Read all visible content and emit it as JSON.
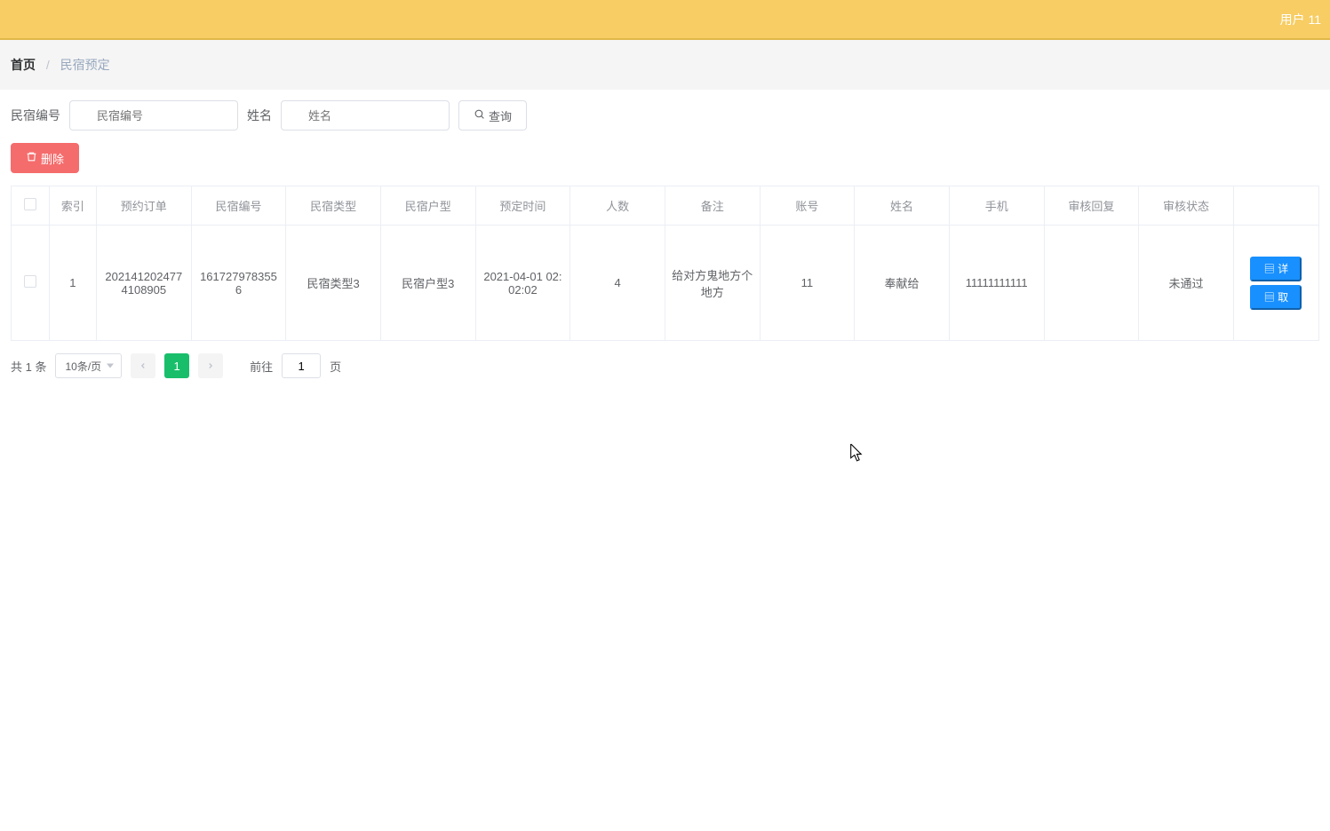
{
  "header": {
    "user_label": "用户 11"
  },
  "breadcrumb": {
    "home": "首页",
    "current": "民宿预定"
  },
  "search": {
    "code_label": "民宿编号",
    "code_placeholder": "民宿编号",
    "name_label": "姓名",
    "name_placeholder": "姓名",
    "query_label": "查询"
  },
  "toolbar": {
    "delete_label": "删除"
  },
  "table": {
    "columns": {
      "index": "索引",
      "order": "预约订单",
      "code": "民宿编号",
      "type": "民宿类型",
      "house": "民宿户型",
      "time": "预定时间",
      "people": "人数",
      "note": "备注",
      "account": "账号",
      "name": "姓名",
      "phone": "手机",
      "reply": "审核回复",
      "status": "审核状态"
    },
    "rows": [
      {
        "index": "1",
        "order": "2021412024774108905",
        "code": "1617279783556",
        "type": "民宿类型3",
        "house": "民宿户型3",
        "time": "2021-04-01 02:02:02",
        "people": "4",
        "note": "给对方鬼地方个地方",
        "account": "11",
        "name": "奉献给",
        "phone": "11111111111",
        "reply": "",
        "status": "未通过"
      }
    ],
    "actions": {
      "detail": "详",
      "cancel": "取"
    }
  },
  "pager": {
    "total_text": "共 1 条",
    "page_size": "10条/页",
    "current": "1",
    "goto_label": "前往",
    "goto_value": "1",
    "page_suffix": "页"
  }
}
